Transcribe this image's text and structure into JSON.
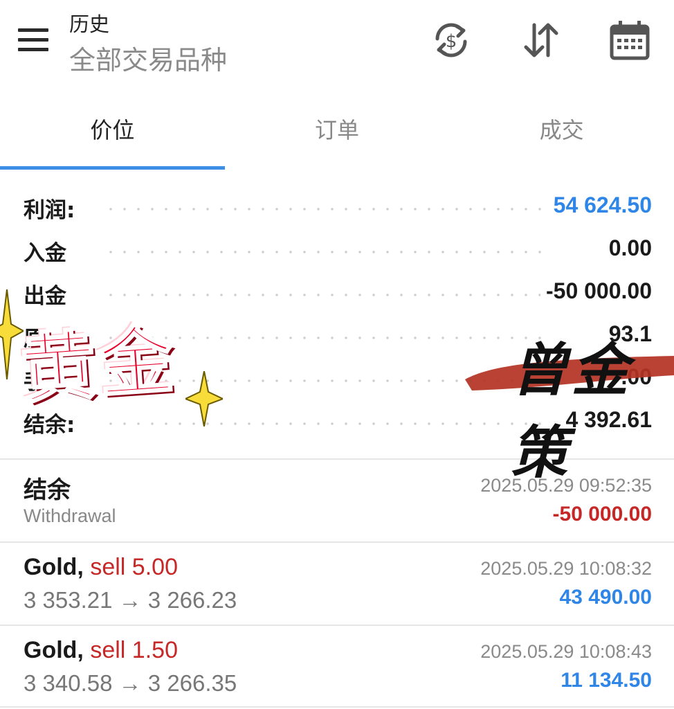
{
  "header": {
    "title": "历史",
    "subtitle": "全部交易品种",
    "icons": [
      "menu-icon",
      "currency-exchange-icon",
      "sort-icon",
      "calendar-icon"
    ]
  },
  "tabs": [
    {
      "label": "价位",
      "active": true
    },
    {
      "label": "订单",
      "active": false
    },
    {
      "label": "成交",
      "active": false
    }
  ],
  "summary": [
    {
      "label": "利润:",
      "value": "54 624.50",
      "color": "#2f86e6"
    },
    {
      "label": "入金",
      "value": "0.00"
    },
    {
      "label": "出金",
      "value": "-50 000.00"
    },
    {
      "label": "原",
      "value": "93.1"
    },
    {
      "label": "手",
      "value": ".00"
    },
    {
      "label": "结余:",
      "value": "4 392.61"
    }
  ],
  "deals": [
    {
      "title": "结余",
      "subtitle": "Withdrawal",
      "time": "2025.05.29 09:52:35",
      "amount": "-50 000.00",
      "amount_color": "#c62828"
    },
    {
      "symbol": "Gold,",
      "side": "sell 5.00",
      "prices": "3 353.21 → 3 266.23",
      "time": "2025.05.29 10:08:32",
      "amount": "43 490.00",
      "amount_color": "#2f86e6"
    },
    {
      "symbol": "Gold,",
      "side": "sell 1.50",
      "prices": "3 340.58 → 3 266.35",
      "time": "2025.05.29 10:08:43",
      "amount": "11 134.50",
      "amount_color": "#2f86e6"
    }
  ],
  "overlay": {
    "sticker_text": "黄金",
    "signature": "曾金策"
  },
  "colors": {
    "accent": "#3d8ee6",
    "profit_blue": "#2f86e6",
    "loss_red": "#c62828"
  }
}
